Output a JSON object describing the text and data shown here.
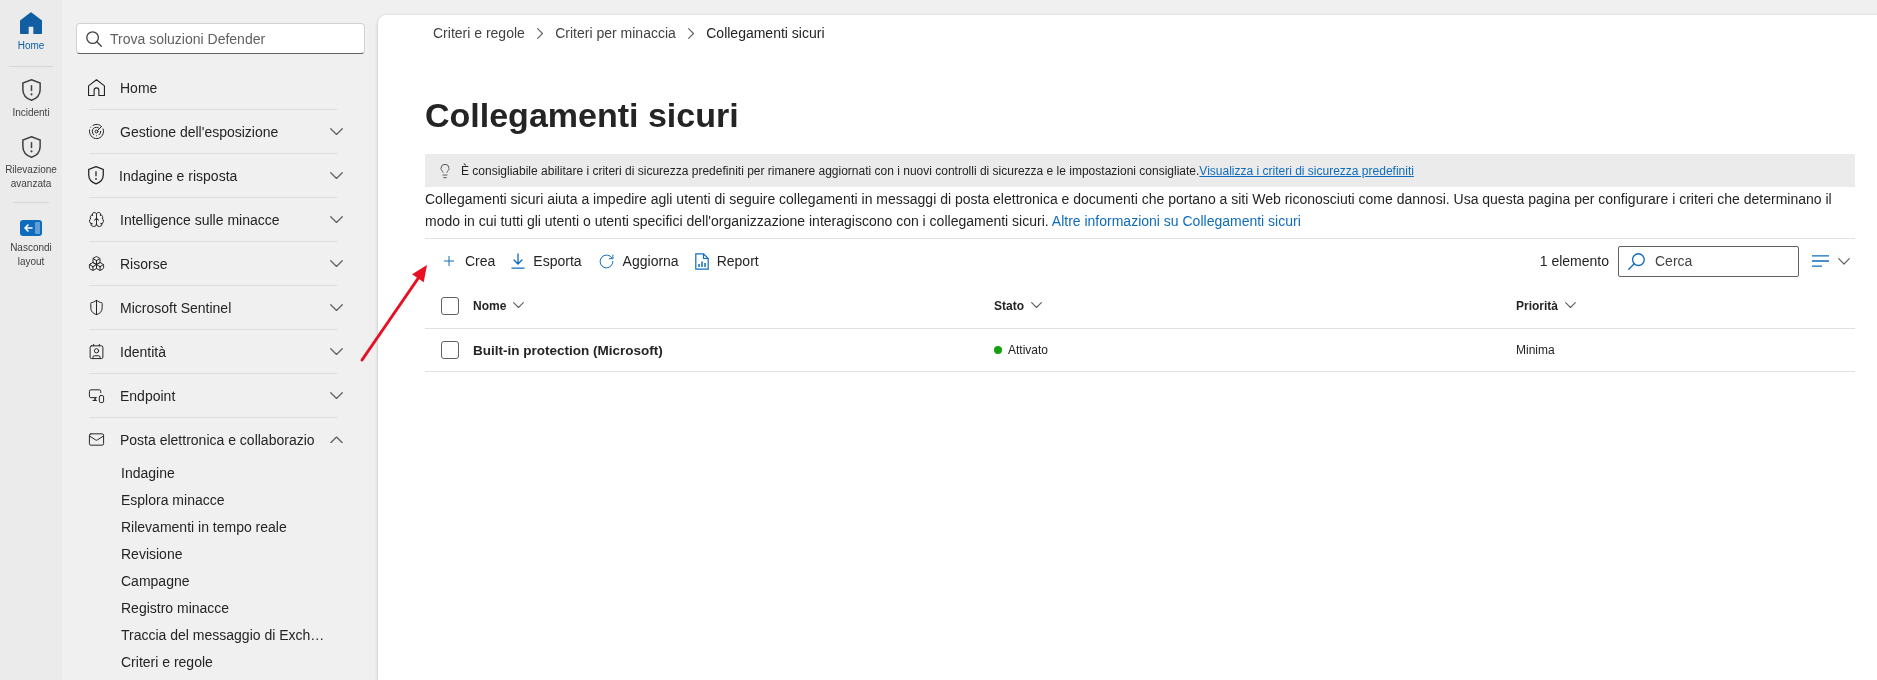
{
  "rail": {
    "items": [
      {
        "label": "Home",
        "selected": true
      },
      {
        "label": "Incidenti",
        "selected": false
      },
      {
        "label": "Rilevazione avanzata",
        "selected": false
      }
    ],
    "collapse": {
      "label": "Nascondi layout"
    }
  },
  "sidebar": {
    "search": {
      "placeholder": "Trova soluzioni Defender"
    },
    "home": {
      "label": "Home"
    },
    "groups": [
      {
        "label": "Gestione dell'esposizione",
        "expanded": false
      },
      {
        "label": "Indagine e risposta",
        "expanded": false
      },
      {
        "label": "Intelligence sulle minacce",
        "expanded": false
      },
      {
        "label": "Risorse",
        "expanded": false
      },
      {
        "label": "Microsoft Sentinel",
        "expanded": false
      },
      {
        "label": "Identità",
        "expanded": false
      },
      {
        "label": "Endpoint",
        "expanded": false
      },
      {
        "label": "Posta elettronica e collaborazio",
        "expanded": true,
        "children": [
          {
            "label": "Indagine"
          },
          {
            "label": "Esplora minacce"
          },
          {
            "label": "Rilevamenti in tempo reale"
          },
          {
            "label": "Revisione"
          },
          {
            "label": "Campagne"
          },
          {
            "label": "Registro minacce"
          },
          {
            "label": "Traccia del messaggio di Exch…"
          },
          {
            "label": "Criteri e regole"
          }
        ]
      }
    ]
  },
  "breadcrumb": [
    "Criteri e regole",
    "Criteri per minaccia",
    "Collegamenti sicuri"
  ],
  "title": "Collegamenti sicuri",
  "notice": {
    "text": "È consigliabile abilitare i criteri di sicurezza predefiniti per rimanere aggiornati con i nuovi controlli di sicurezza e le impostazioni consigliate.",
    "link": "Visualizza i criteri di sicurezza predefiniti"
  },
  "description": {
    "text": "Collegamenti sicuri aiuta a impedire agli utenti di seguire collegamenti in messaggi di posta elettronica e documenti che portano a siti Web riconosciuti come dannosi. Usa questa pagina per configurare i criteri che determinano il modo in cui tutti gli utenti o utenti specifici dell'organizzazione interagiscono con i collegamenti sicuri.",
    "link": "Altre informazioni su Collegamenti sicuri"
  },
  "toolbar": {
    "actions": [
      {
        "label": "Crea"
      },
      {
        "label": "Esporta"
      },
      {
        "label": "Aggiorna"
      },
      {
        "label": "Report"
      }
    ],
    "count": "1 elemento",
    "search": {
      "placeholder": "Cerca"
    }
  },
  "table": {
    "select_all": {
      "checked": false
    },
    "columns": [
      {
        "label": "Nome"
      },
      {
        "label": "Stato"
      },
      {
        "label": "Priorità"
      }
    ],
    "rows": [
      {
        "checked": false,
        "name": "Built-in protection (Microsoft)",
        "status": {
          "label": "Attivato",
          "color": "#13a10e"
        },
        "priority": "Minima"
      }
    ]
  }
}
